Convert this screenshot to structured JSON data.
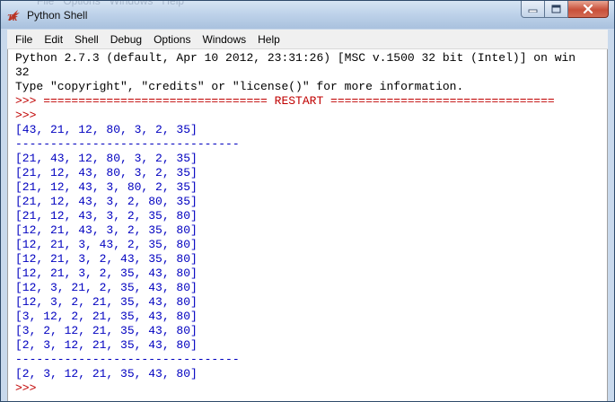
{
  "window": {
    "title": "Python Shell",
    "ghost_menu": "File   Options   Windows   Help"
  },
  "menu": [
    "File",
    "Edit",
    "Shell",
    "Debug",
    "Options",
    "Windows",
    "Help"
  ],
  "shell": {
    "lines": [
      {
        "text": "Python 2.7.3 (default, Apr 10 2012, 23:31:26) [MSC v.1500 32 bit (Intel)] on win",
        "color": "black"
      },
      {
        "text": "32",
        "color": "black"
      },
      {
        "text": "Type \"copyright\", \"credits\" or \"license()\" for more information.",
        "color": "black"
      },
      {
        "text": ">>> ================================ RESTART ================================",
        "color": "red"
      },
      {
        "text": ">>> ",
        "color": "red"
      },
      {
        "text": "[43, 21, 12, 80, 3, 2, 35]",
        "color": "blue"
      },
      {
        "text": "--------------------------------",
        "color": "blue"
      },
      {
        "text": "[21, 43, 12, 80, 3, 2, 35]",
        "color": "blue"
      },
      {
        "text": "[21, 12, 43, 80, 3, 2, 35]",
        "color": "blue"
      },
      {
        "text": "[21, 12, 43, 3, 80, 2, 35]",
        "color": "blue"
      },
      {
        "text": "[21, 12, 43, 3, 2, 80, 35]",
        "color": "blue"
      },
      {
        "text": "[21, 12, 43, 3, 2, 35, 80]",
        "color": "blue"
      },
      {
        "text": "[12, 21, 43, 3, 2, 35, 80]",
        "color": "blue"
      },
      {
        "text": "[12, 21, 3, 43, 2, 35, 80]",
        "color": "blue"
      },
      {
        "text": "[12, 21, 3, 2, 43, 35, 80]",
        "color": "blue"
      },
      {
        "text": "[12, 21, 3, 2, 35, 43, 80]",
        "color": "blue"
      },
      {
        "text": "[12, 3, 21, 2, 35, 43, 80]",
        "color": "blue"
      },
      {
        "text": "[12, 3, 2, 21, 35, 43, 80]",
        "color": "blue"
      },
      {
        "text": "[3, 12, 2, 21, 35, 43, 80]",
        "color": "blue"
      },
      {
        "text": "[3, 2, 12, 21, 35, 43, 80]",
        "color": "blue"
      },
      {
        "text": "[2, 3, 12, 21, 35, 43, 80]",
        "color": "blue"
      },
      {
        "text": "--------------------------------",
        "color": "blue"
      },
      {
        "text": "[2, 3, 12, 21, 35, 43, 80]",
        "color": "blue"
      },
      {
        "text": ">>> ",
        "color": "red"
      }
    ]
  },
  "colors": {
    "output": "#0000c0",
    "prompt": "#c00000",
    "banner": "#000000"
  },
  "icons": {
    "app": "tk-feather-icon",
    "minimize": "minimize-icon",
    "maximize": "maximize-icon",
    "close": "close-icon"
  }
}
